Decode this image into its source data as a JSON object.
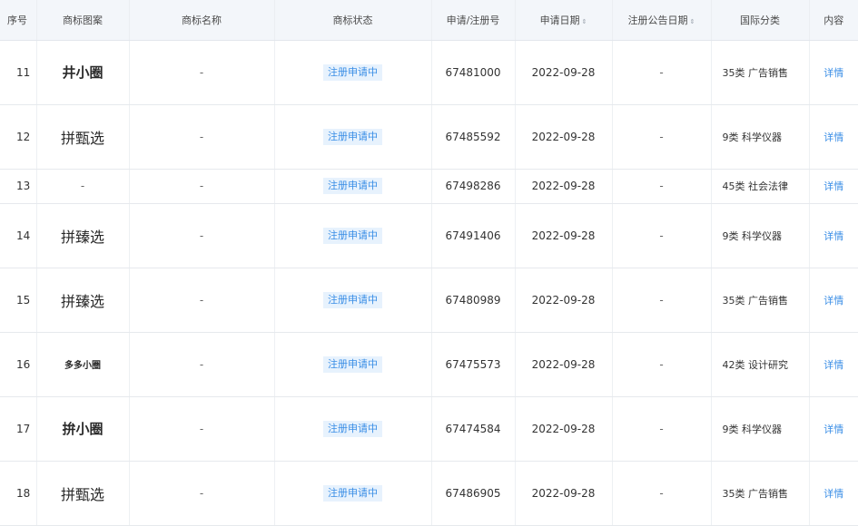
{
  "columns": {
    "seq": "序号",
    "pattern": "商标图案",
    "name": "商标名称",
    "status": "商标状态",
    "reg_no": "申请/注册号",
    "apply_date": "申请日期",
    "announce_date": "注册公告日期",
    "intl_class": "国际分类",
    "content": "内容"
  },
  "sort_indicator": "⇕",
  "rows": [
    {
      "seq": "11",
      "pattern": "井小圈",
      "name": "-",
      "status": "注册申请中",
      "reg_no": "67481000",
      "apply_date": "2022-09-28",
      "announce_date": "-",
      "intl_class": "35类 广告销售",
      "content": "详情"
    },
    {
      "seq": "12",
      "pattern": "拼甄选",
      "name": "-",
      "status": "注册申请中",
      "reg_no": "67485592",
      "apply_date": "2022-09-28",
      "announce_date": "-",
      "intl_class": "9类 科学仪器",
      "content": "详情"
    },
    {
      "seq": "13",
      "pattern": "-",
      "name": "-",
      "status": "注册申请中",
      "reg_no": "67498286",
      "apply_date": "2022-09-28",
      "announce_date": "-",
      "intl_class": "45类 社会法律",
      "content": "详情"
    },
    {
      "seq": "14",
      "pattern": "拼臻选",
      "name": "-",
      "status": "注册申请中",
      "reg_no": "67491406",
      "apply_date": "2022-09-28",
      "announce_date": "-",
      "intl_class": "9类 科学仪器",
      "content": "详情"
    },
    {
      "seq": "15",
      "pattern": "拼臻选",
      "name": "-",
      "status": "注册申请中",
      "reg_no": "67480989",
      "apply_date": "2022-09-28",
      "announce_date": "-",
      "intl_class": "35类 广告销售",
      "content": "详情"
    },
    {
      "seq": "16",
      "pattern": "多多小圈",
      "name": "-",
      "status": "注册申请中",
      "reg_no": "67475573",
      "apply_date": "2022-09-28",
      "announce_date": "-",
      "intl_class": "42类 设计研究",
      "content": "详情"
    },
    {
      "seq": "17",
      "pattern": "拚小圈",
      "name": "-",
      "status": "注册申请中",
      "reg_no": "67474584",
      "apply_date": "2022-09-28",
      "announce_date": "-",
      "intl_class": "9类 科学仪器",
      "content": "详情"
    },
    {
      "seq": "18",
      "pattern": "拼甄选",
      "name": "-",
      "status": "注册申请中",
      "reg_no": "67486905",
      "apply_date": "2022-09-28",
      "announce_date": "-",
      "intl_class": "35类 广告销售",
      "content": "详情"
    }
  ],
  "colors": {
    "header_bg": "#f3f6fa",
    "status_bg": "#e7f2fd",
    "accent": "#3a8ee6"
  }
}
